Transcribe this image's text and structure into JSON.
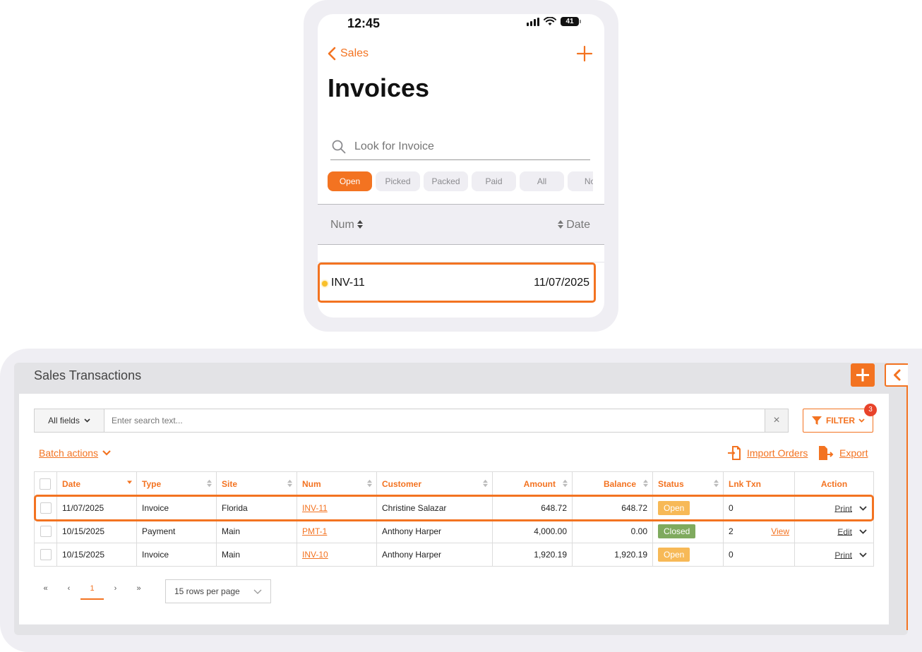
{
  "phone": {
    "time": "12:45",
    "battery": "41",
    "back_label": "Sales",
    "title": "Invoices",
    "search_placeholder": "Look for Invoice",
    "chips": [
      "Open",
      "Picked",
      "Packed",
      "Paid",
      "All",
      "No"
    ],
    "active_chip": "Open",
    "header_num": "Num",
    "header_date": "Date",
    "rows": [
      {
        "num": "INV-11",
        "date": "11/07/2025"
      }
    ]
  },
  "desktop": {
    "panel_title": "Sales Transactions",
    "fields_label": "All fields",
    "search_placeholder": "Enter search text...",
    "clear_label": "×",
    "filter_label": "FILTER",
    "filter_count": "3",
    "batch_label": "Batch actions",
    "import_label": "Import Orders",
    "export_label": "Export",
    "columns": [
      "Date",
      "Type",
      "Site",
      "Num",
      "Customer",
      "Amount",
      "Balance",
      "Status",
      "Lnk Txn",
      "Action"
    ],
    "rows": [
      {
        "date": "11/07/2025",
        "type": "Invoice",
        "site": "Florida",
        "num": "INV-11",
        "customer": "Christine Salazar",
        "amount": "648.72",
        "balance": "648.72",
        "status": "Open",
        "lnk": "0",
        "view": "",
        "action": "Print"
      },
      {
        "date": "10/15/2025",
        "type": "Payment",
        "site": "Main",
        "num": "PMT-1",
        "customer": "Anthony Harper",
        "amount": "4,000.00",
        "balance": "0.00",
        "status": "Closed",
        "lnk": "2",
        "view": "View",
        "action": "Edit"
      },
      {
        "date": "10/15/2025",
        "type": "Invoice",
        "site": "Main",
        "num": "INV-10",
        "customer": "Anthony Harper",
        "amount": "1,920.19",
        "balance": "1,920.19",
        "status": "Open",
        "lnk": "0",
        "view": "",
        "action": "Print"
      }
    ],
    "pager": {
      "first": "«",
      "prev": "‹",
      "current": "1",
      "next": "›",
      "last": "»"
    },
    "rows_per_page": "15 rows per page"
  },
  "colors": {
    "accent": "#f37321",
    "open": "#f7b957",
    "closed": "#7faa5e",
    "badge": "#e8432a"
  }
}
